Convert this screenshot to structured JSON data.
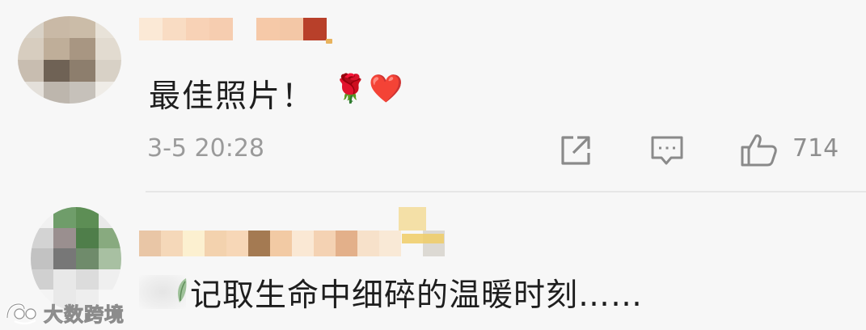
{
  "comments": [
    {
      "avatar": {
        "icon": "pixelated-avatar",
        "tiles": [
          "#d9d2c7",
          "#c9b9a6",
          "#cbbca8",
          "#e8e2d8",
          "#d7cdbf",
          "#bfae99",
          "#a89682",
          "#e2dbd0",
          "#c8bdb0",
          "#6f6255",
          "#8d7e6d",
          "#d8d1c6",
          "#e4e0da",
          "#bdb6ad",
          "#c6c1ba",
          "#efece7"
        ]
      },
      "username_blocks": [
        "#fbe9d6",
        "#f9dcc3",
        "#f8d2b6",
        "#f6cdb0",
        "#f7f7f7",
        "#f6c9a8",
        "#f3c7a6",
        "#b8402a"
      ],
      "text": "最佳照片！",
      "emojis": [
        "🌹",
        "❤️"
      ],
      "timestamp": "3-5 20:28",
      "actions": {
        "share_icon": "share-icon",
        "reply_icon": "comment-icon",
        "like_icon": "thumbs-up-icon",
        "like_count": "714"
      }
    },
    {
      "avatar": {
        "icon": "pixelated-avatar",
        "tiles": [
          "#f1f1f1",
          "#6f9d6a",
          "#5d8e55",
          "#e9e9e9",
          "#d3d3d3",
          "#9a8f8f",
          "#4f7e4a",
          "#88aa7f",
          "#c2c2c2",
          "#777777",
          "#6f8b6b",
          "#a8c0a2",
          "#d0d0d0",
          "#e8e8e8",
          "#dcdcdc",
          "#efefef",
          "#f4f4f4",
          "#e9e9e9",
          "#eeeeee",
          "#f7f7f7"
        ]
      },
      "username_blocks": [
        "#e9c6a6",
        "#f5d8b9",
        "#fcf0d0",
        "#f3d2ae",
        "#f7d7b7",
        "#a47a52",
        "#f2caa4",
        "#fae8d4",
        "#f4d2b3",
        "#e3b08a",
        "#f7e1ca",
        "#f9e9d6",
        "#f7f7f7",
        "#dcd9d3"
      ],
      "text": "记取生命中细碎的温暖时刻……"
    }
  ],
  "watermark": {
    "text": "大数跨境",
    "icon": "brand-logo-icon"
  }
}
